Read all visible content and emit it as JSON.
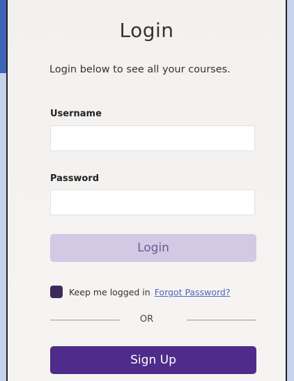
{
  "login": {
    "title": "Login",
    "subtitle": "Login below to see all your courses.",
    "username_label": "Username",
    "username_value": "",
    "password_label": "Password",
    "password_value": "",
    "login_button": "Login",
    "keep_logged_in": "Keep me logged in",
    "forgot_password": "Forgot Password?",
    "or_text": "OR",
    "signup_button": "Sign Up"
  },
  "colors": {
    "primary": "#4f2b8b",
    "login_button_bg": "#d3c9e4",
    "checkbox": "#3c2a5c",
    "link": "#4b67b8",
    "window_accent": "#3f63b7"
  },
  "icons": [
    "checkbox-checked-icon"
  ]
}
